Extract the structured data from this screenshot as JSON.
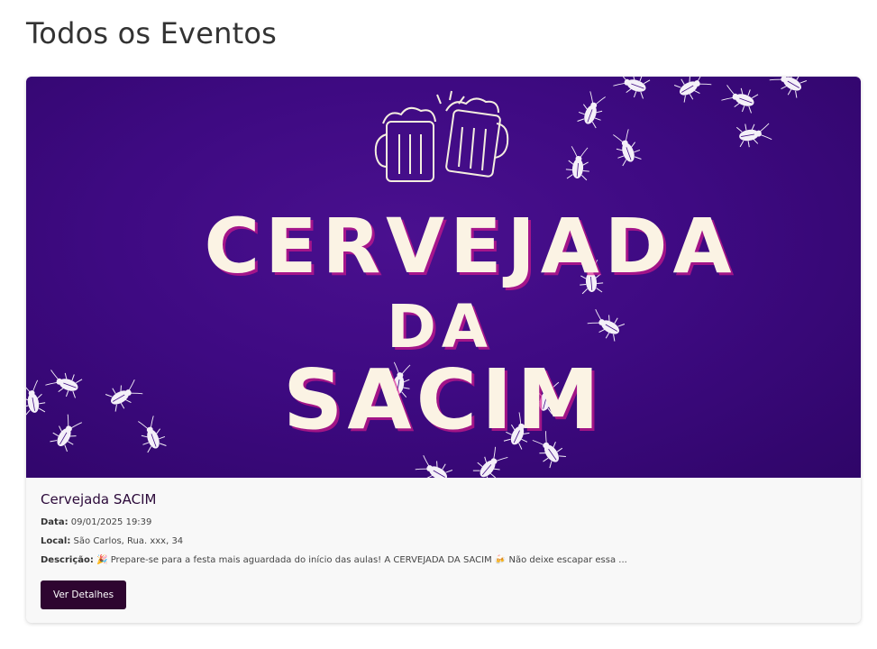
{
  "page": {
    "title": "Todos os Eventos"
  },
  "event": {
    "banner": {
      "line1": "CERVEJADA",
      "line2": "DA",
      "line3": "SACIM",
      "background_color": "#3e0a82",
      "text_color": "#fbf3e4",
      "illustrations": [
        "beer-mugs-icon",
        "cockroach-icon"
      ]
    },
    "name": "Cervejada SACIM",
    "date_label": "Data:",
    "date_value": "09/01/2025 19:39",
    "location_label": "Local:",
    "location_value": "São Carlos, Rua. xxx, 34",
    "description_label": "Descrição:",
    "description_value": "🎉 Prepare-se para a festa mais aguardada do início das aulas! A CERVEJADA DA SACIM 🍻 Não deixe escapar essa ...",
    "details_button_label": "Ver Detalhes",
    "button_color": "#2e0530"
  }
}
